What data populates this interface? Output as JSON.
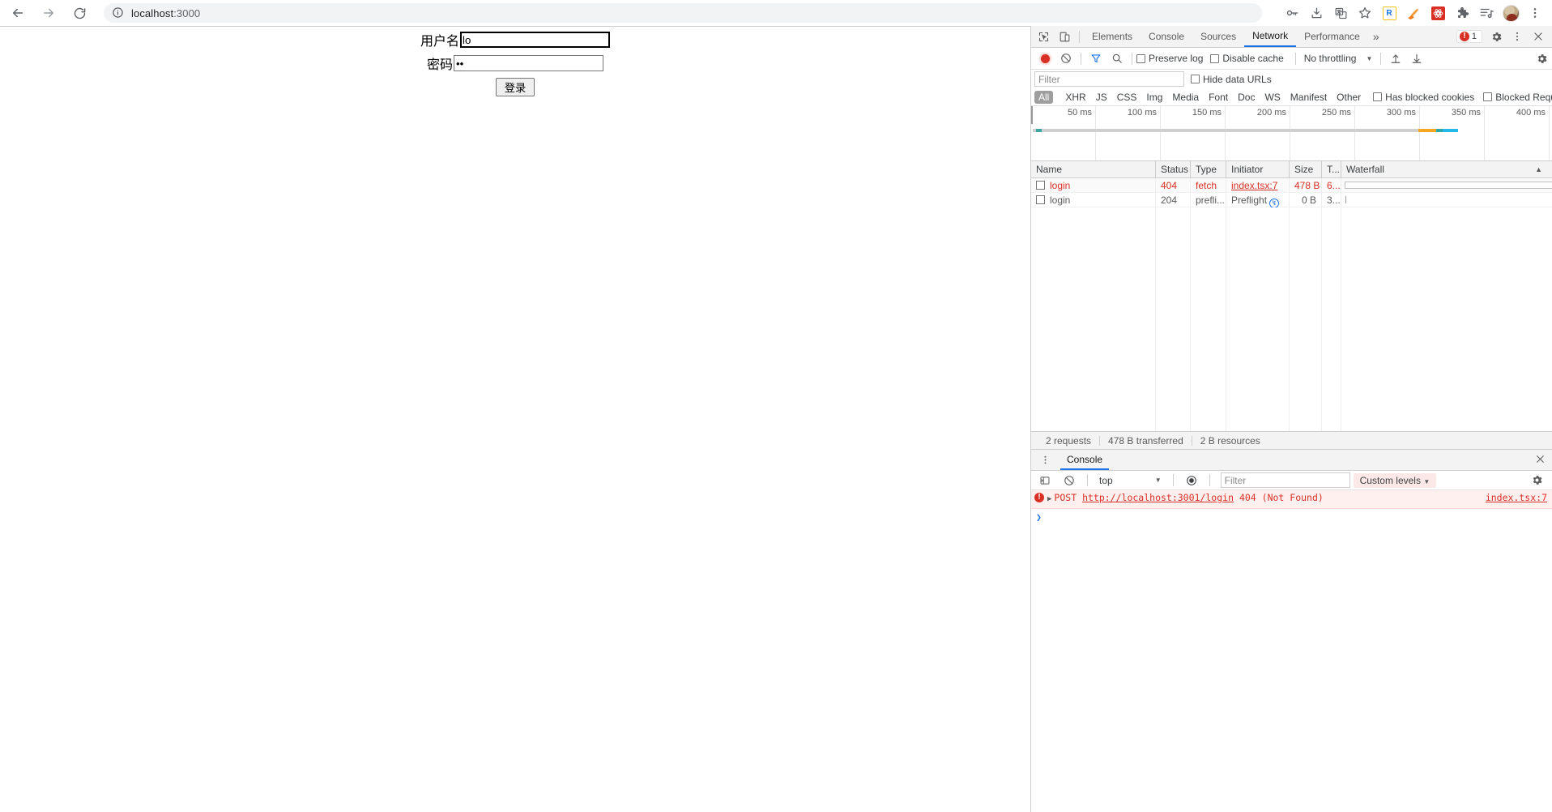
{
  "browser": {
    "nav": {
      "back_icon": "arrow-left-icon",
      "forward_icon": "arrow-right-icon",
      "reload_icon": "reload-icon"
    },
    "omnibox": {
      "site_info_icon": "info-circle-icon",
      "host": "localhost",
      "port": ":3000",
      "full_url": "localhost:3000"
    },
    "toolbar_icons": [
      {
        "name": "password-key-icon",
        "label": "Passwords"
      },
      {
        "name": "downloads-icon",
        "label": "Downloads"
      },
      {
        "name": "translate-icon",
        "label": "Translate"
      },
      {
        "name": "bookmark-star-icon",
        "label": "Bookmark"
      },
      {
        "name": "extension-r-icon",
        "label": "R"
      },
      {
        "name": "extension-brush-icon",
        "label": "Brush"
      },
      {
        "name": "extension-red-icon",
        "label": "Extension"
      },
      {
        "name": "extensions-puzzle-icon",
        "label": "Extensions"
      },
      {
        "name": "media-list-icon",
        "label": "Media list"
      },
      {
        "name": "profile-avatar",
        "label": "Profile"
      },
      {
        "name": "chrome-menu-icon",
        "label": "Menu"
      }
    ]
  },
  "page": {
    "form": {
      "username_label": "用户名",
      "username_value": "lo",
      "password_label": "密码",
      "password_value": "••",
      "submit_label": "登录"
    }
  },
  "devtools": {
    "tabbar": {
      "inspect_icon": "inspect-element-icon",
      "device_icon": "device-toolbar-icon",
      "tabs": [
        {
          "label": "Elements",
          "active": false
        },
        {
          "label": "Console",
          "active": false
        },
        {
          "label": "Sources",
          "active": false
        },
        {
          "label": "Network",
          "active": true
        },
        {
          "label": "Performance",
          "active": false
        }
      ],
      "more_label": "»",
      "error_count": "1",
      "settings_icon": "gear-icon",
      "menu_icon": "kebab-menu-icon",
      "close_icon": "close-icon"
    },
    "network_toolbar": {
      "record_icon": "record-stop-icon",
      "clear_icon": "clear-icon",
      "filter_icon": "funnel-icon",
      "search_icon": "search-icon",
      "preserve_log_label": "Preserve log",
      "preserve_log_checked": false,
      "disable_cache_label": "Disable cache",
      "disable_cache_checked": false,
      "throttling_label": "No throttling",
      "import_icon": "import-har-icon",
      "export_icon": "export-har-icon",
      "settings_icon": "gear-icon"
    },
    "filter_bar": {
      "filter_placeholder": "Filter",
      "filter_value": "",
      "hide_data_urls_label": "Hide data URLs",
      "hide_data_urls_checked": false
    },
    "type_filters": {
      "chips": [
        "All",
        "XHR",
        "JS",
        "CSS",
        "Img",
        "Media",
        "Font",
        "Doc",
        "WS",
        "Manifest",
        "Other"
      ],
      "selected": "All",
      "has_blocked_cookies_label": "Has blocked cookies",
      "blocked_requests_label": "Blocked Requests"
    },
    "overview": {
      "ticks": [
        "50 ms",
        "100 ms",
        "150 ms",
        "200 ms",
        "250 ms",
        "300 ms",
        "350 ms",
        "400 ms"
      ]
    },
    "requests_table": {
      "columns": [
        "Name",
        "Status",
        "Type",
        "Initiator",
        "Size",
        "T...",
        "Waterfall"
      ],
      "sort_indicator": "▲",
      "rows": [
        {
          "name": "login",
          "status": "404",
          "type": "fetch",
          "initiator": "index.tsx:7",
          "initiator_is_link": true,
          "size": "478 B",
          "time": "6...",
          "error": true
        },
        {
          "name": "login",
          "status": "204",
          "type": "prefli...",
          "initiator": "Preflight",
          "initiator_is_link": false,
          "size": "0 B",
          "time": "3...",
          "error": false
        }
      ]
    },
    "status_bar": {
      "requests": "2 requests",
      "transferred": "478 B transferred",
      "resources": "2 B resources"
    },
    "drawer": {
      "menu_icon": "kebab-menu-icon",
      "tab_label": "Console",
      "close_icon": "close-icon",
      "toolbar": {
        "sidebar_icon": "console-sidebar-icon",
        "clear_icon": "clear-console-icon",
        "context_value": "top",
        "eye_icon": "live-expression-icon",
        "filter_placeholder": "Filter",
        "filter_value": "",
        "levels_label": "Custom levels",
        "settings_icon": "gear-icon"
      },
      "messages": [
        {
          "severity": "error",
          "expand_arrow": "▶",
          "method": "POST",
          "url": "http://localhost:3001/login",
          "status": "404",
          "status_text": "(Not Found)",
          "source": "index.tsx:7"
        }
      ],
      "prompt_symbol": "❯"
    }
  },
  "colors": {
    "accent": "#1a73e8",
    "error": "#d93025",
    "link": "#1a0dab",
    "chrome_bg": "#f1f3f4",
    "panel_bg": "#f3f3f3",
    "border": "#cdcdcd"
  }
}
